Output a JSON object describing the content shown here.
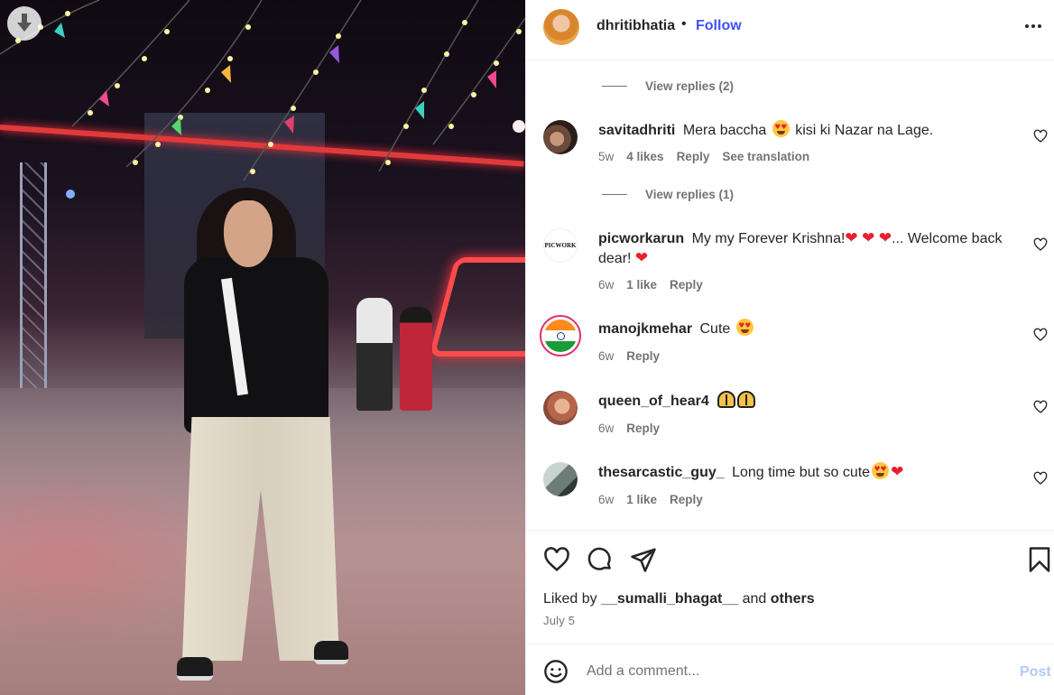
{
  "post": {
    "username": "dhritibhatia",
    "separator": "•",
    "follow_label": "Follow",
    "more_icon": "more-horizontal-icon",
    "download_icon": "download-arrow-icon"
  },
  "comments": [
    {
      "type": "replies",
      "label": "View replies (2)"
    },
    {
      "type": "comment",
      "username": "savitadhriti",
      "text_a": "Mera baccha",
      "text_b": "kisi ki Nazar na Lage.",
      "time": "5w",
      "likes": "4 likes",
      "reply": "Reply",
      "translation": "See translation"
    },
    {
      "type": "replies",
      "label": "View replies (1)"
    },
    {
      "type": "comment",
      "username": "picworkarun",
      "text_a": "My my Forever Krishna!",
      "text_b": "... Welcome back dear!",
      "avatar_label": "PICWORK",
      "time": "6w",
      "likes": "1 like",
      "reply": "Reply"
    },
    {
      "type": "comment",
      "username": "manojkmehar",
      "text_a": "Cute",
      "time": "6w",
      "reply": "Reply"
    },
    {
      "type": "comment",
      "username": "queen_of_hear4",
      "time": "6w",
      "reply": "Reply"
    },
    {
      "type": "comment",
      "username": "thesarcastic_guy_",
      "text_a": "Long time but so cute",
      "time": "6w",
      "likes": "1 like",
      "reply": "Reply"
    }
  ],
  "actions": {
    "liked_by_prefix": "Liked by",
    "liked_by_user": "__sumalli_bhagat__",
    "liked_by_and": "and",
    "liked_by_others": "others",
    "date": "July 5"
  },
  "composer": {
    "placeholder": "Add a comment...",
    "post_label": "Post"
  },
  "colors": {
    "follow_blue": "#4150f7",
    "post_disabled": "#b3c9f7",
    "heart_red": "#e8202e",
    "muted_text": "#737373"
  }
}
